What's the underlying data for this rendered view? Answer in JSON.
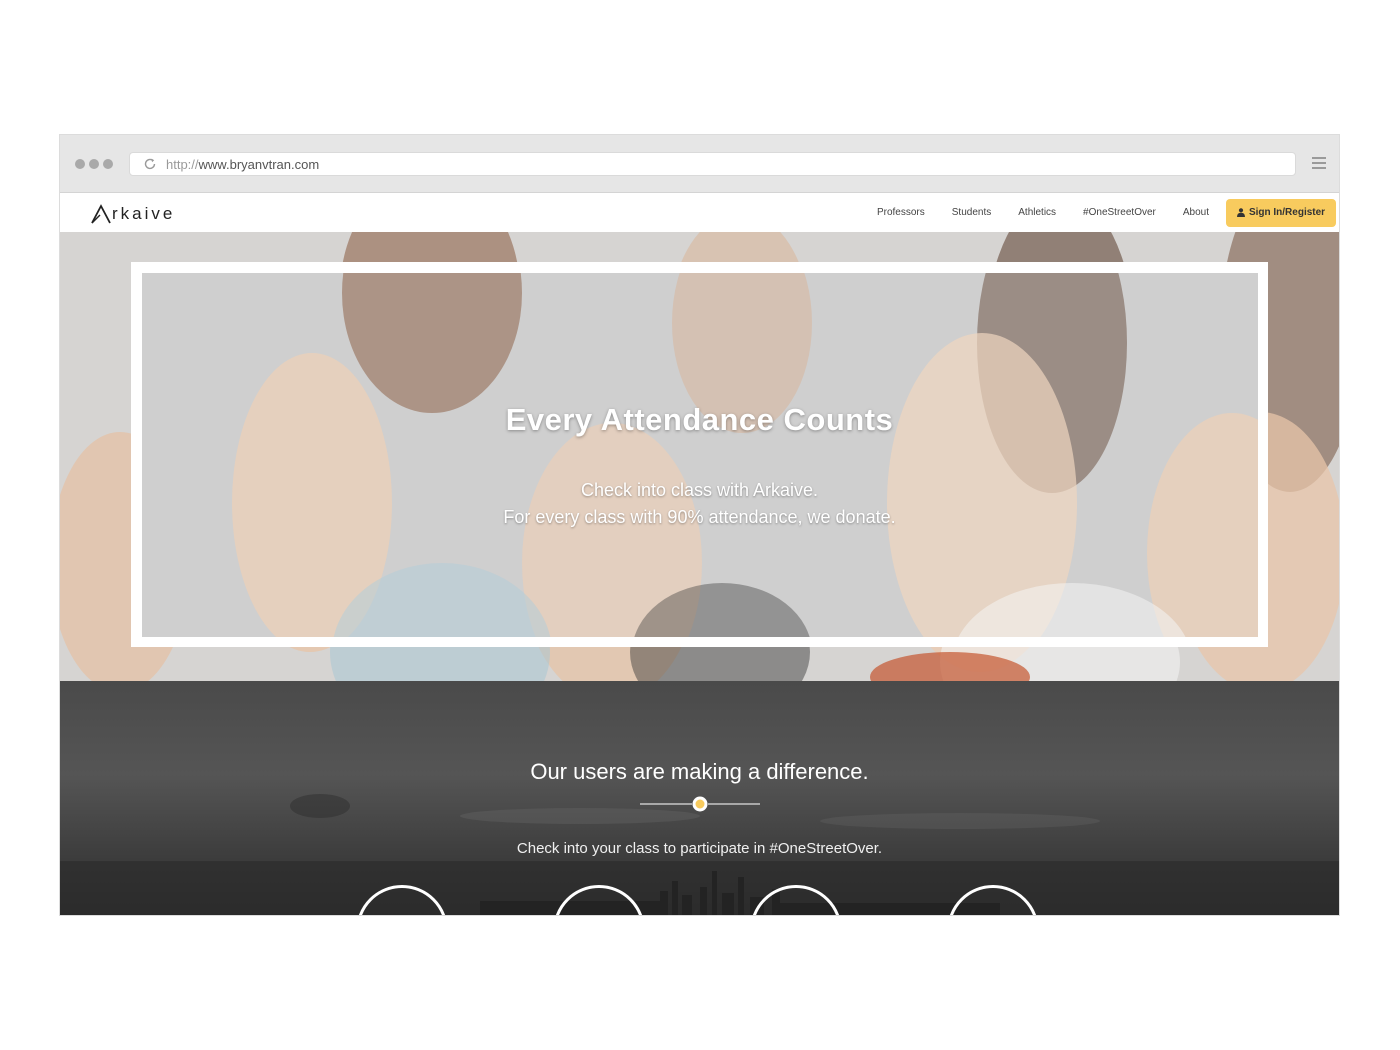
{
  "browser": {
    "url_scheme": "http://",
    "url_host": "www.bryanvtran.com"
  },
  "navbar": {
    "logo_text": "rkaive",
    "links": [
      "Professors",
      "Students",
      "Athletics",
      "#OneStreetOver",
      "About"
    ],
    "signin_label": "Sign In/Register",
    "accent_color": "#f8cb5e"
  },
  "hero": {
    "title": "Every Attendance Counts",
    "line1": "Check into class with Arkaive.",
    "line2": "For every class with 90% attendance, we donate."
  },
  "impact": {
    "title": "Our users are making a difference.",
    "subtitle": "Check into your class to participate in #OneStreetOver.",
    "accent_color": "#f8cb5e"
  },
  "icons": [
    "reload-icon",
    "menu-icon",
    "logo-a-icon",
    "user-icon"
  ]
}
